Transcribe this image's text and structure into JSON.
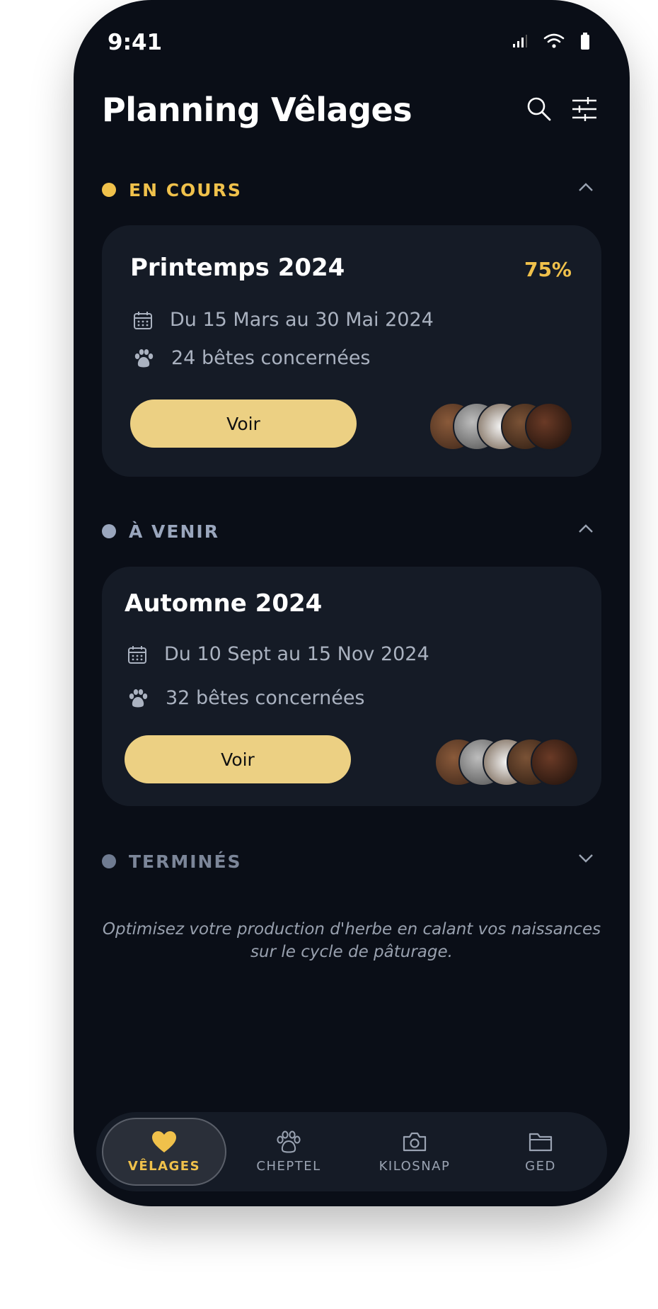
{
  "status": {
    "time": "9:41"
  },
  "header": {
    "title": "Planning Vêlages"
  },
  "sections": [
    {
      "label": "EN COURS",
      "color": "#f0c14b",
      "expanded": true,
      "card": {
        "title": "Printemps 2024",
        "progress": "75%",
        "dates": "Du 15 Mars au 30 Mai 2024",
        "animals": "24 bêtes concernées",
        "button": "Voir"
      }
    },
    {
      "label": "À VENIR",
      "color": "#9aa6bd",
      "expanded": true,
      "card": {
        "title": "Automne 2024",
        "dates": "Du 10 Sept au 15 Nov 2024",
        "animals": "32 bêtes concernées",
        "button": "Voir"
      }
    },
    {
      "label": "TERMINÉS",
      "color": "#6f7b91",
      "expanded": false
    }
  ],
  "footnote": "Optimisez votre production d'herbe en calant vos naissances sur le cycle de pâturage.",
  "tabs": [
    {
      "label": "VÊLAGES",
      "icon": "heart-icon",
      "active": true
    },
    {
      "label": "CHEPTEL",
      "icon": "paw-icon",
      "active": false
    },
    {
      "label": "KILOSNAP",
      "icon": "camera-icon",
      "active": false
    },
    {
      "label": "GED",
      "icon": "folder-icon",
      "active": false
    }
  ]
}
